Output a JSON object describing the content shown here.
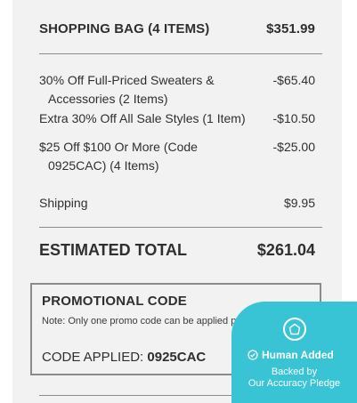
{
  "summary": {
    "bag_label": "SHOPPING BAG (4 ITEMS)",
    "bag_total": "$351.99"
  },
  "discounts": [
    {
      "line1": "30% Off Full-Priced Sweaters &",
      "line2": "Accessories (2 Items)",
      "value": "-$65.40"
    },
    {
      "line1": "Extra 30% Off All Sale Styles (1 Item)",
      "line2": "",
      "value": "-$10.50"
    },
    {
      "line1": "$25 Off $100 Or More (Code",
      "line2": "0925CAC) (4 Items)",
      "value": "-$25.00"
    }
  ],
  "shipping": {
    "label": "Shipping",
    "value": "$9.95"
  },
  "estimated": {
    "label": "ESTIMATED TOTAL",
    "value": "$261.04"
  },
  "promo": {
    "title": "PROMOTIONAL CODE",
    "note": "Note: Only one promo code can be applied per order.",
    "applied_label": "CODE APPLIED:",
    "applied_code": "0925CAC"
  },
  "badge": {
    "title": "Human Added",
    "line1": "Backed by",
    "line2": "Our Accuracy Pledge",
    "color": "#38c4d4"
  }
}
